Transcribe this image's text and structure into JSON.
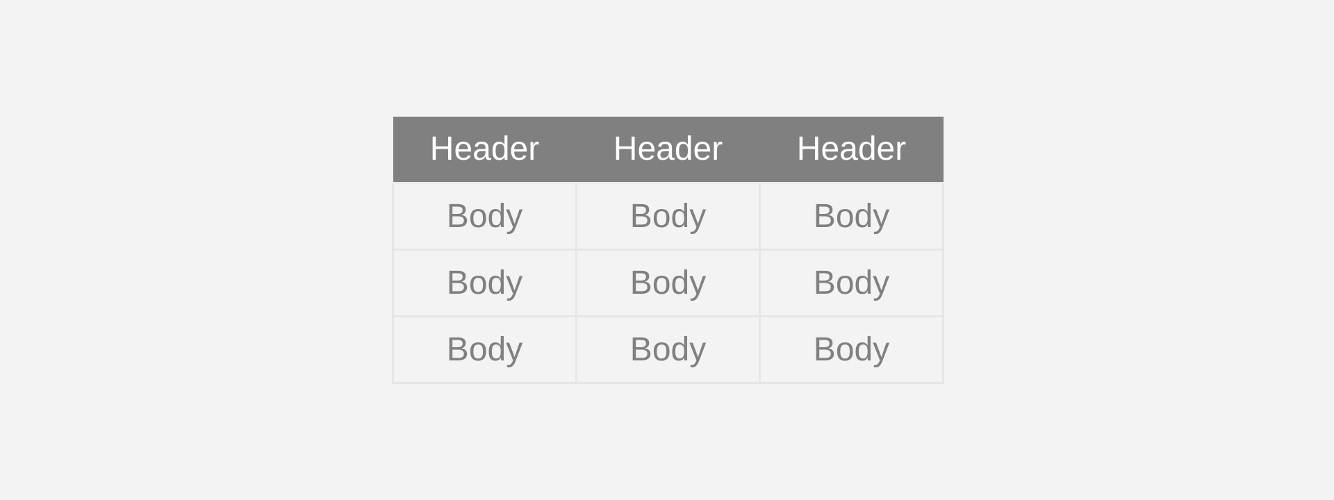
{
  "table": {
    "headers": [
      "Header",
      "Header",
      "Header"
    ],
    "rows": [
      [
        "Body",
        "Body",
        "Body"
      ],
      [
        "Body",
        "Body",
        "Body"
      ],
      [
        "Body",
        "Body",
        "Body"
      ]
    ]
  },
  "colors": {
    "page_background": "#f3f3f3",
    "header_background": "#808080",
    "header_text": "#ffffff",
    "body_text": "#808080",
    "cell_border": "#e6e6e6"
  }
}
